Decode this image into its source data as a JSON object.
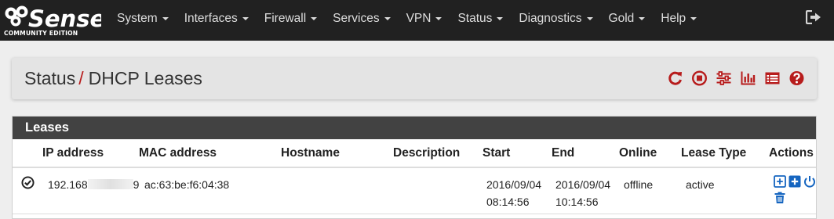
{
  "app": {
    "logo_text": "Sense",
    "logo_subtitle": "COMMUNITY EDITION"
  },
  "nav": {
    "items": [
      {
        "label": "System"
      },
      {
        "label": "Interfaces"
      },
      {
        "label": "Firewall"
      },
      {
        "label": "Services"
      },
      {
        "label": "VPN"
      },
      {
        "label": "Status"
      },
      {
        "label": "Diagnostics"
      },
      {
        "label": "Gold"
      },
      {
        "label": "Help"
      }
    ],
    "logout_icon": "logout-icon"
  },
  "breadcrumb": {
    "parent": "Status",
    "separator": "/",
    "current": "DHCP Leases",
    "icons": [
      "reload-icon",
      "stop-icon",
      "sliders-icon",
      "bar-chart-icon",
      "log-icon",
      "help-icon"
    ]
  },
  "leases_panel": {
    "title": "Leases",
    "columns": [
      "IP address",
      "MAC address",
      "Hostname",
      "Description",
      "Start",
      "End",
      "Online",
      "Lease Type",
      "Actions"
    ],
    "rows": [
      {
        "status_icon": "check-circle-icon",
        "ip_prefix": "192.168",
        "ip_suffix": "9",
        "mac": "ac:63:be:f6:04:38",
        "hostname": "",
        "description": "",
        "start_date": "2016/09/04",
        "start_time": "08:14:56",
        "end_date": "2016/09/04",
        "end_time": "10:14:56",
        "online": "offline",
        "lease_type": "active",
        "actions": [
          "add-static-mapping-icon",
          "add-mapping-icon",
          "wake-on-lan-icon",
          "delete-icon"
        ]
      }
    ]
  },
  "colors": {
    "navbar": "#212121",
    "accent_red": "#b71c1c",
    "action_blue": "#1565c0",
    "panel_heading": "#424242"
  }
}
